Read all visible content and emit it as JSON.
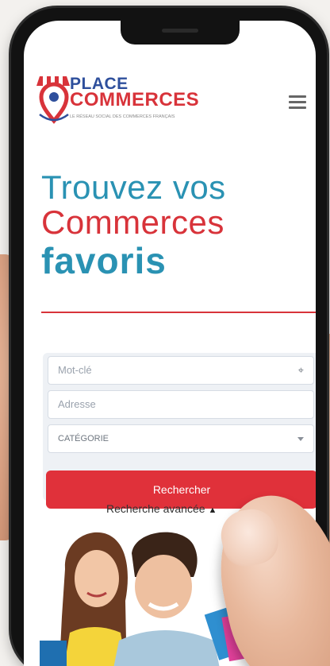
{
  "header": {
    "logo_line1": "PLACE",
    "logo_line2": "COMMERCES",
    "logo_tagline": "LE RÉSEAU SOCIAL DES COMMERCES FRANÇAIS",
    "menu_icon": "hamburger-icon"
  },
  "hero": {
    "line1": "Trouvez vos",
    "line2": "Commerces",
    "line3": "favoris"
  },
  "search": {
    "keyword_placeholder": "Mot-clé",
    "address_placeholder": "Adresse",
    "category_value": "CATÉGORIE",
    "submit_label": "Rechercher",
    "advanced_label": "Recherche avancée"
  },
  "colors": {
    "brand_blue": "#2a92b3",
    "brand_red": "#d8333a",
    "logo_blue": "#2e4f9c"
  }
}
